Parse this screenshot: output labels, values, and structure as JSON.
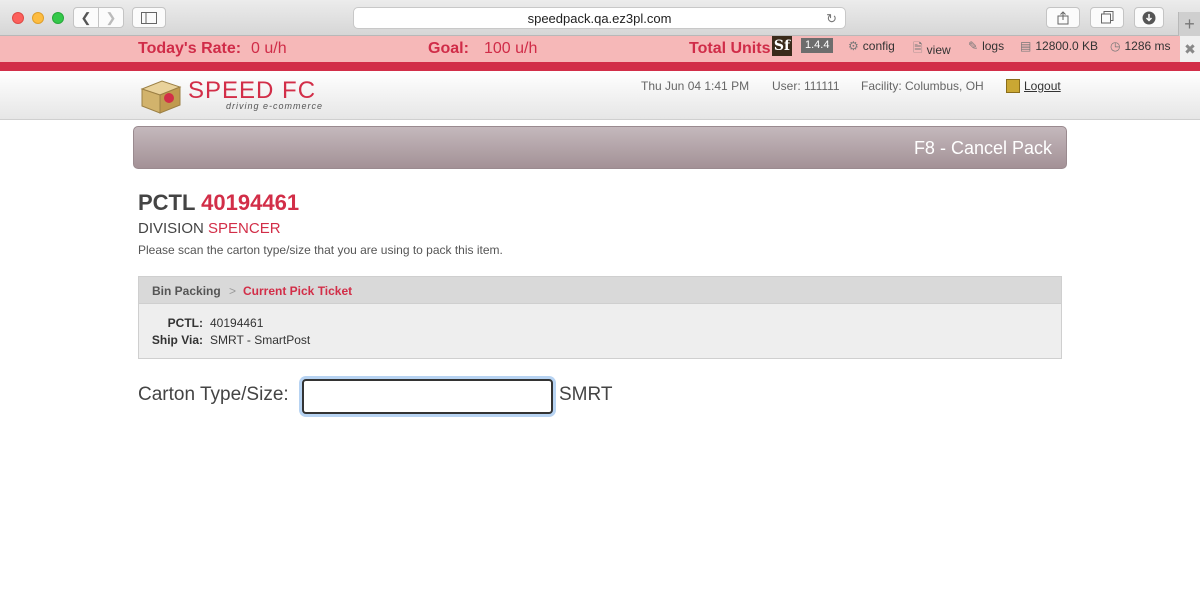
{
  "browser": {
    "url": "speedpack.qa.ez3pl.com"
  },
  "stats": {
    "rate_label": "Today's Rate:",
    "rate_value": "0  u/h",
    "goal_label": "Goal:",
    "goal_value": "100  u/h",
    "units_label": "Total Units:"
  },
  "symfony": {
    "logo": "Sf",
    "version": "1.4.4",
    "config": "config",
    "view": "view",
    "logs": "logs",
    "memory": "12800.0 KB",
    "time": "1286 ms"
  },
  "header": {
    "logo_text": "SPEED FC",
    "logo_tagline": "driving e-commerce",
    "datetime": "Thu Jun 04 1:41 PM",
    "user": "User: 111111",
    "facility": "Facility: Columbus, OH",
    "logout": "Logout"
  },
  "banner": {
    "title": "F8 - Cancel Pack"
  },
  "main": {
    "pctl_label": "PCTL",
    "pctl_number": "40194461",
    "division_label": "DIVISION",
    "division_value": "SPENCER",
    "instruction": "Please scan the carton type/size that you are using to pack this item."
  },
  "panel": {
    "crumb_1": "Bin Packing",
    "crumb_sep": ">",
    "crumb_2": "Current Pick Ticket",
    "rows": [
      {
        "label": "PCTL:",
        "value": "40194461"
      },
      {
        "label": "Ship Via:",
        "value": "SMRT - SmartPost"
      }
    ]
  },
  "carton": {
    "label": "Carton Type/Size:",
    "value": "",
    "suffix": "SMRT"
  },
  "colors": {
    "accent": "#d22e48",
    "stats_bg": "#f6b8b8"
  }
}
